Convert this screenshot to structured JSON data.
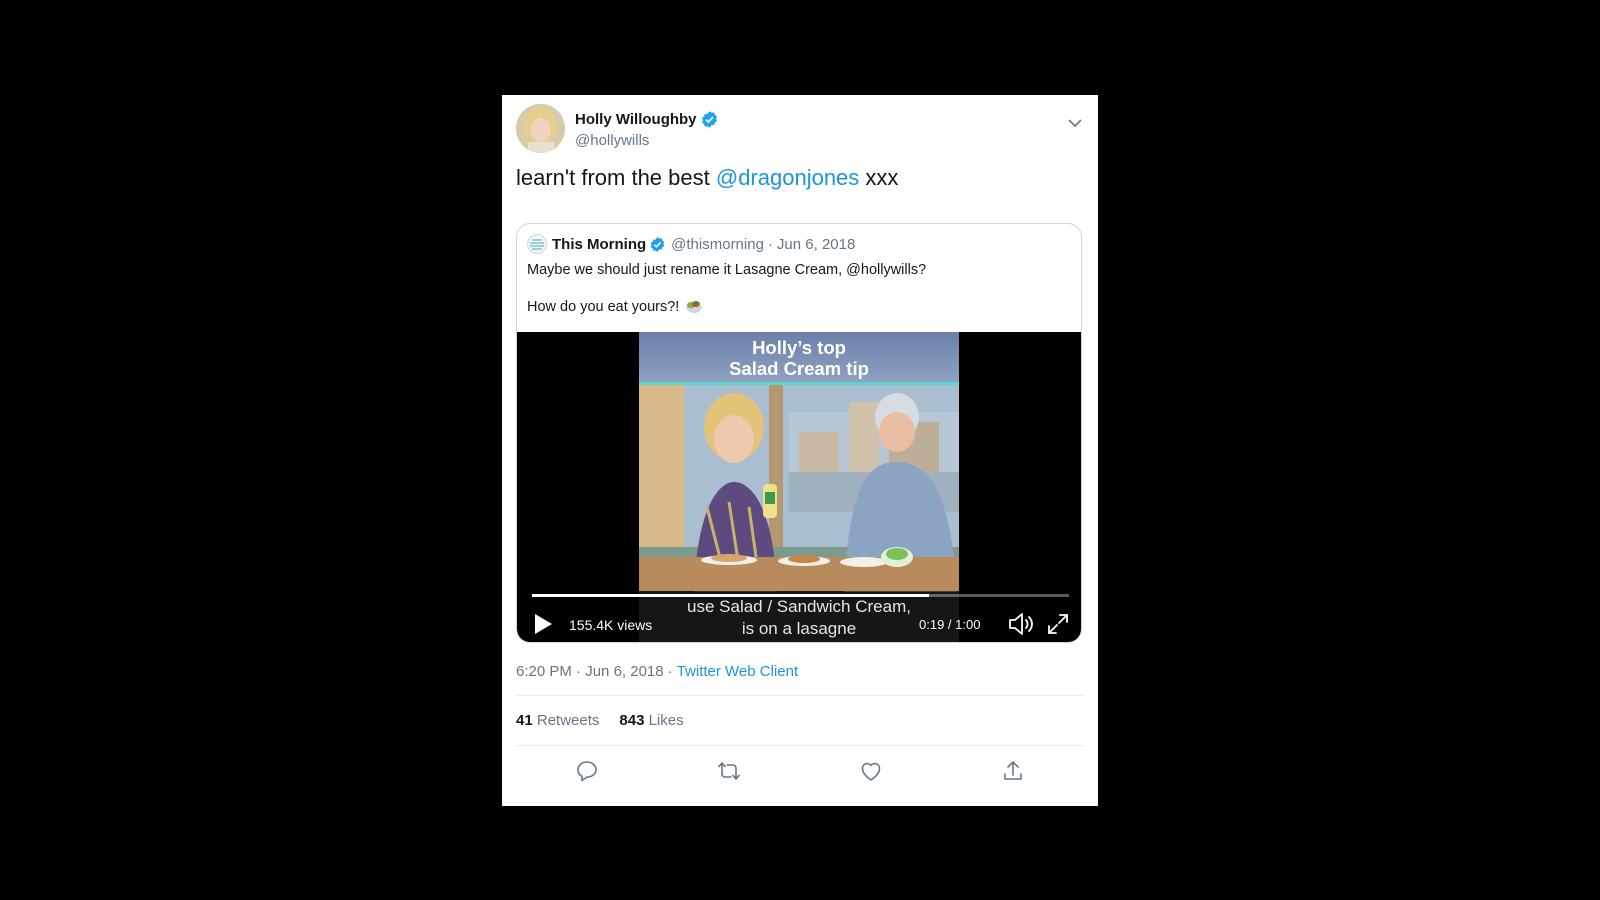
{
  "author": {
    "name": "Holly Willoughby",
    "handle": "@hollywills"
  },
  "tweet": {
    "text_before": "learn't from the best ",
    "mention": "@dragonjones",
    "text_after": " xxx"
  },
  "quoted": {
    "name": "This Morning",
    "handle": "@thismorning",
    "separator": "·",
    "date": "Jun 6, 2018",
    "line1": "Maybe we should just rename it Lasagne Cream, @hollywills?",
    "line2": "How do you eat yours?!",
    "emoji": "salad-bowl"
  },
  "video": {
    "overlay_title_line1": "Holly’s top",
    "overlay_title_line2": "Salad Cream tip",
    "views": "155.4K views",
    "caption_line1": "use Salad / Sandwich Cream,",
    "caption_line2": "is on a lasagne",
    "time": "0:19 / 1:00",
    "progress": 0.74
  },
  "meta": {
    "time": "6:20 PM",
    "dot": "·",
    "date": "Jun 6, 2018",
    "source": "Twitter Web Client"
  },
  "stats": {
    "retweets_count": "41",
    "retweets_label": "Retweets",
    "likes_count": "843",
    "likes_label": "Likes"
  },
  "colors": {
    "link": "#1b95e0",
    "muted": "#657786",
    "verified": "#1da1f2"
  }
}
